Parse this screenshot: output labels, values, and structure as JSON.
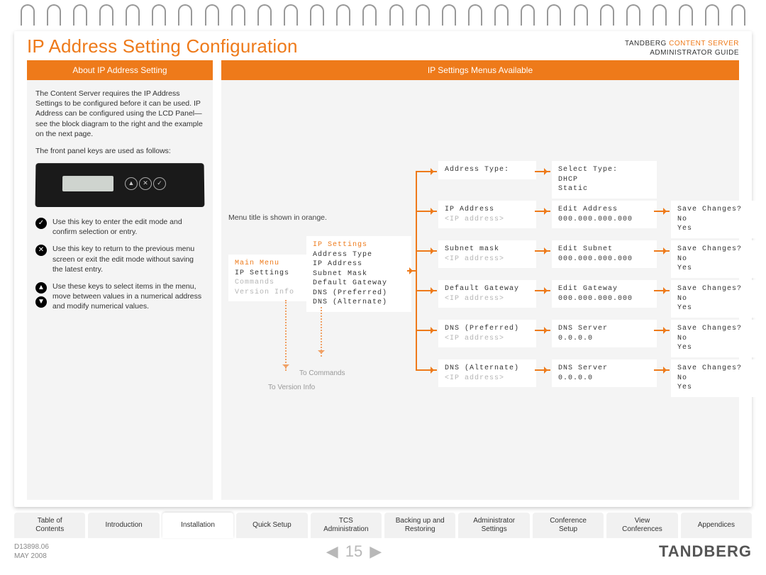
{
  "header": {
    "title": "IP Address Setting Configuration",
    "brand_line1_a": "TANDBERG ",
    "brand_line1_b": "CONTENT SERVER",
    "brand_line2": "ADMINISTRATOR GUIDE"
  },
  "left": {
    "heading": "About IP Address Setting",
    "para1": "The Content Server requires the IP Address Settings to be configured before it can be used. IP Address can be configured using the LCD Panel—see the block diagram to the right and the example on the next page.",
    "para2": "The front panel keys are used as follows:",
    "btn_up": "▲",
    "btn_x": "✕",
    "btn_check": "✓",
    "key_check_icon": "✓",
    "key_check_text": "Use this key to enter the edit mode and confirm selection or entry.",
    "key_x_icon": "✕",
    "key_x_text": "Use this key to return to the previous menu screen or exit the edit mode without saving the latest entry.",
    "key_up_icon": "▲",
    "key_down_icon": "▼",
    "key_arrows_text": "Use these keys to select items in the menu, move between values in a numerical address and modify numerical values."
  },
  "right": {
    "heading": "IP Settings Menus Available",
    "note_orange": "Menu title is shown in orange.",
    "main_menu": {
      "title": "Main Menu",
      "l1": "IP Settings",
      "l2": "Commands",
      "l3": "Version Info"
    },
    "ip_settings": {
      "title": "IP Settings",
      "l1": "Address Type",
      "l2": "IP Address",
      "l3": "Subnet Mask",
      "l4": "Default Gateway",
      "l5": "DNS (Preferred)",
      "l6": "DNS (Alternate)"
    },
    "to_commands": "To Commands",
    "to_version": "To Version Info",
    "rows": {
      "addrType": {
        "a": "Address Type:",
        "b1": "Select Type:",
        "b2": "DHCP",
        "b3": "Static"
      },
      "ip": {
        "a1": "IP Address",
        "a2": "<IP address>",
        "b1": "Edit Address",
        "b2": "000.000.000.000",
        "c1": "Save Changes?",
        "c2": "No",
        "c3": "Yes"
      },
      "subnet": {
        "a1": "Subnet mask",
        "a2": "<IP address>",
        "b1": "Edit Subnet",
        "b2": "000.000.000.000",
        "c1": "Save Changes?",
        "c2": "No",
        "c3": "Yes"
      },
      "gw": {
        "a1": "Default Gateway",
        "a2": "<IP address>",
        "b1": "Edit Gateway",
        "b2": "000.000.000.000",
        "c1": "Save Changes?",
        "c2": "No",
        "c3": "Yes"
      },
      "dns1": {
        "a1": "DNS (Preferred)",
        "a2": "<IP address>",
        "b1": "DNS Server",
        "b2": "0.0.0.0",
        "c1": "Save Changes?",
        "c2": "No",
        "c3": "Yes"
      },
      "dns2": {
        "a1": "DNS (Alternate)",
        "a2": "<IP address>",
        "b1": "DNS Server",
        "b2": "0.0.0.0",
        "c1": "Save Changes?",
        "c2": "No",
        "c3": "Yes"
      }
    }
  },
  "tabs": {
    "t1a": "Table of",
    "t1b": "Contents",
    "t2": "Introduction",
    "t3": "Installation",
    "t4": "Quick Setup",
    "t5a": "TCS",
    "t5b": "Administration",
    "t6a": "Backing up and",
    "t6b": "Restoring",
    "t7a": "Administrator",
    "t7b": "Settings",
    "t8a": "Conference",
    "t8b": "Setup",
    "t9a": "View",
    "t9b": "Conferences",
    "t10": "Appendices"
  },
  "footer": {
    "docnum": "D13898.06",
    "date": "MAY 2008",
    "page": "15",
    "prev": "◀",
    "next": "▶",
    "logo": "TANDBERG"
  }
}
